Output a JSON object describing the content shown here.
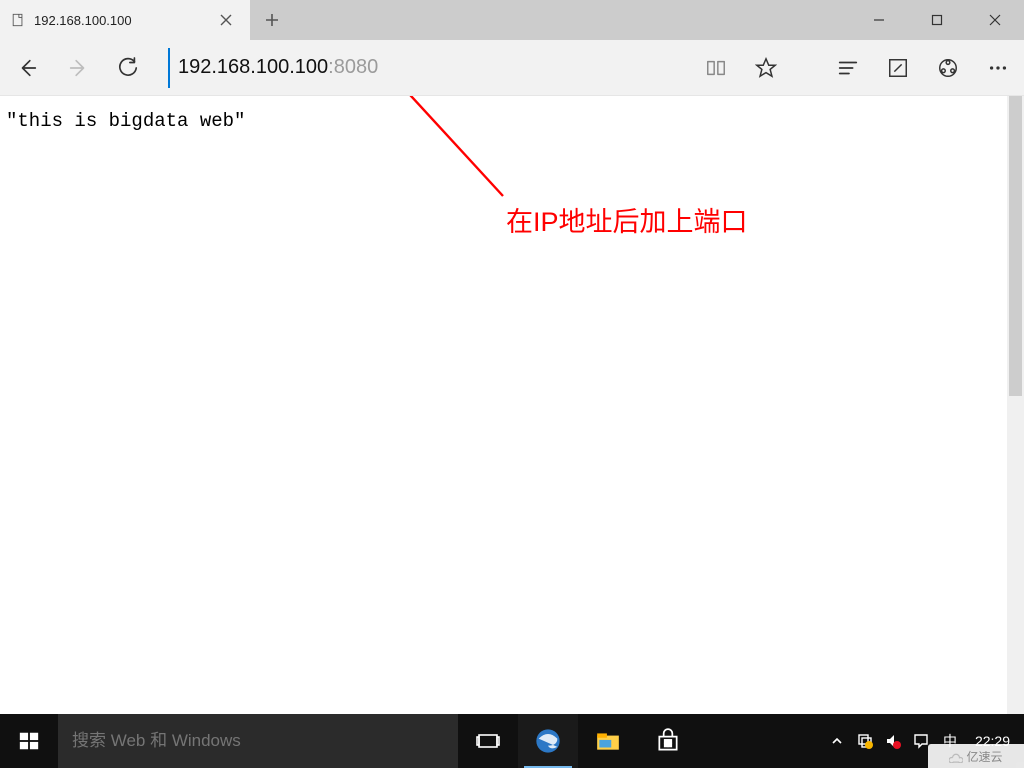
{
  "window": {
    "tab_title": "192.168.100.100",
    "minimize_label": "Minimize",
    "maximize_label": "Maximize",
    "close_label": "Close"
  },
  "toolbar": {
    "address_host": "192.168.100.100",
    "address_port": ":8080"
  },
  "page": {
    "body_text": "\"this is bigdata web\""
  },
  "annotation": {
    "text": "在IP地址后加上端口"
  },
  "taskbar": {
    "search_placeholder": "搜索 Web 和 Windows",
    "clock": "22:29",
    "ime": "中"
  },
  "watermark": {
    "text": "亿速云"
  }
}
